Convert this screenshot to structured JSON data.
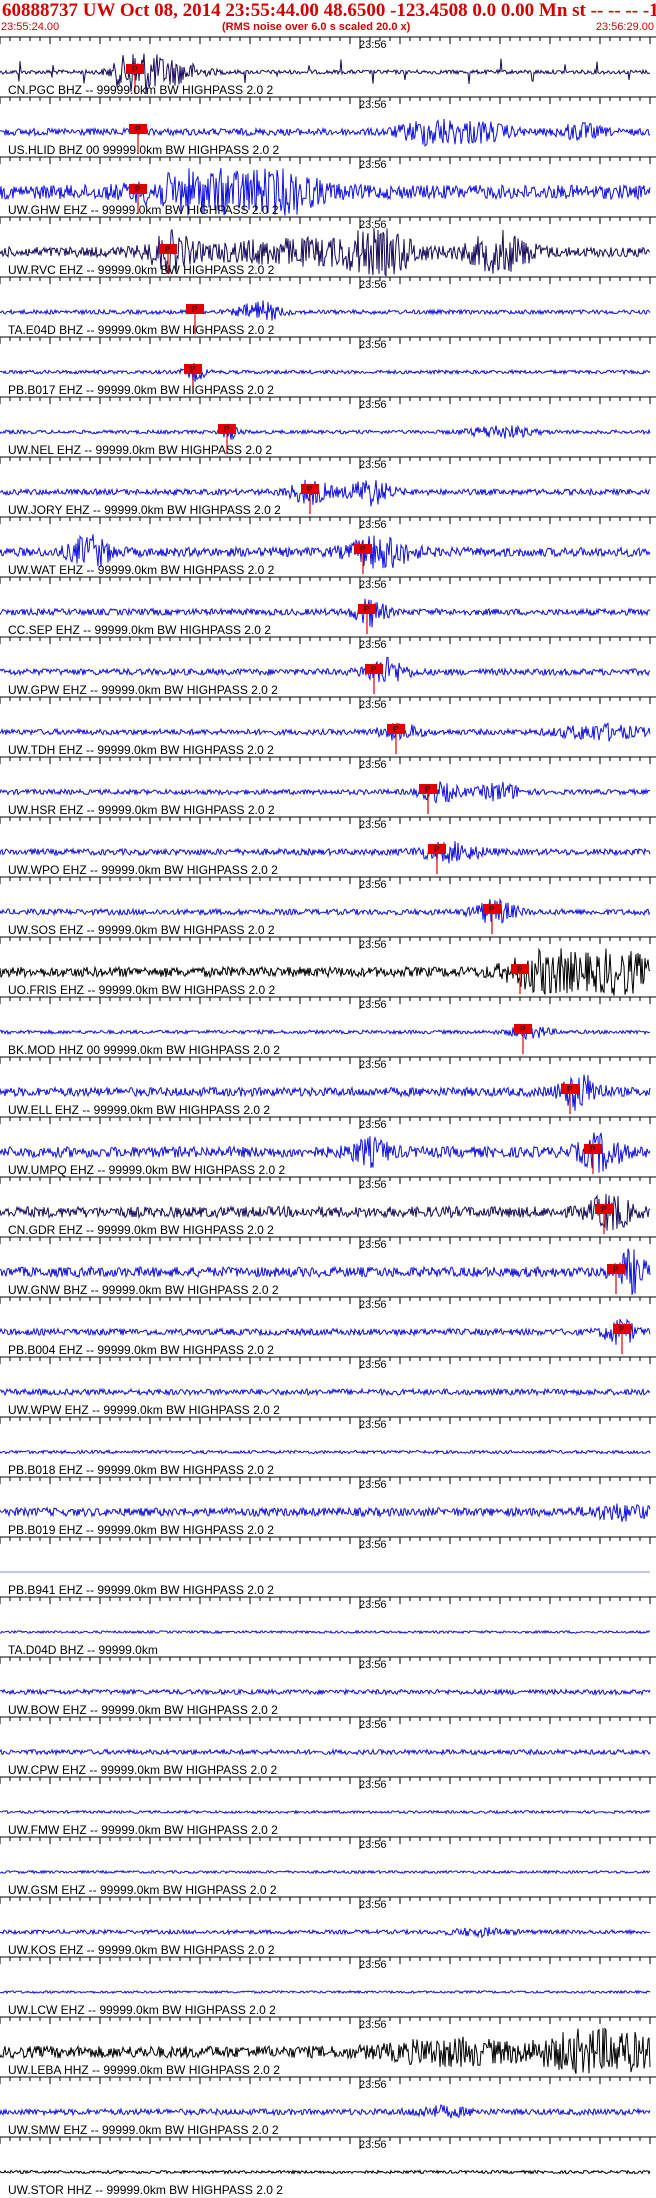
{
  "header": {
    "title": "60888737 UW Oct 08, 2014 23:55:44.00   48.6500  -123.4508  0.0 0.00 Mn st -- -- --  -1",
    "start_time": "23:55:24.00",
    "subtitle": "(RMS noise over 6.0 s scaled 20.0 x)",
    "end_time": "23:56:29.00"
  },
  "colors": {
    "title_red": "#d40000",
    "blue_trace": "#1010e0",
    "navy_trace": "#1a0a5c",
    "black_trace": "#000000",
    "pick_red": "#e00000"
  },
  "chart_data": {
    "type": "line",
    "x_unit": "s",
    "x_start": "23:55:24.00",
    "x_end": "23:56:29.00",
    "x_range": [
      0,
      65
    ],
    "minute_label": "23:56",
    "minute_offset_s": 36,
    "pick_label": "P",
    "stations": [
      {
        "label": "CN.PGC BHZ -- 99999.0km BW  HIGHPASS  2.0  2",
        "color": "navy",
        "pick_s": 13.5,
        "amp": 1.0,
        "event": [
          {
            "t": 13.5,
            "a": 1.0,
            "w": 2
          },
          {
            "t": 17,
            "a": 0.6,
            "w": 3
          }
        ],
        "noise": 0.1,
        "spikes": true
      },
      {
        "label": "US.HLID BHZ 00 99999.0km BW  HIGHPASS  2.0  2",
        "color": "blue",
        "pick_s": 13.8,
        "amp": 0.7,
        "event": [
          {
            "t": 43,
            "a": 0.8,
            "w": 3
          },
          {
            "t": 48,
            "a": 0.6,
            "w": 3
          },
          {
            "t": 58,
            "a": 0.5,
            "w": 2
          }
        ],
        "noise": 0.25
      },
      {
        "label": "UW.GHW EHZ -- 99999.0km BW  HIGHPASS  2.0  2",
        "color": "blue",
        "pick_s": 13.8,
        "amp": 1.0,
        "event": [
          {
            "t": 21,
            "a": 1.0,
            "w": 6
          },
          {
            "t": 28,
            "a": 0.8,
            "w": 4
          }
        ],
        "noise": 0.35
      },
      {
        "label": "UW.RVC EHZ -- 99999.0km BW  HIGHPASS  2.0  2",
        "color": "navy",
        "pick_s": 16.8,
        "amp": 1.0,
        "event": [
          {
            "t": 17,
            "a": 0.8,
            "w": 2
          },
          {
            "t": 38,
            "a": 1.0,
            "w": 3
          },
          {
            "t": 50,
            "a": 0.9,
            "w": 3
          },
          {
            "t": 30,
            "a": 0.5,
            "w": 10
          }
        ],
        "noise": 0.25
      },
      {
        "label": "TA.E04D BHZ -- 99999.0km BW  HIGHPASS  2.0  2",
        "color": "blue",
        "pick_s": 19.5,
        "amp": 0.7,
        "event": [
          {
            "t": 26,
            "a": 0.7,
            "w": 2
          }
        ],
        "noise": 0.15
      },
      {
        "label": "PB.B017 EHZ -- 99999.0km BW  HIGHPASS  2.0  2",
        "color": "blue",
        "pick_s": 19.3,
        "amp": 0.6,
        "event": [
          {
            "t": 19.5,
            "a": 0.7,
            "w": 1
          }
        ],
        "noise": 0.15
      },
      {
        "label": "UW.NEL EHZ -- 99999.0km BW  HIGHPASS  2.0  2",
        "color": "blue",
        "pick_s": 22.7,
        "amp": 0.6,
        "event": [
          {
            "t": 23,
            "a": 0.5,
            "w": 1
          },
          {
            "t": 50,
            "a": 0.5,
            "w": 3
          }
        ],
        "noise": 0.15
      },
      {
        "label": "UW.JORY EHZ -- 99999.0km BW  HIGHPASS  2.0  2",
        "color": "blue",
        "pick_s": 31.0,
        "amp": 0.8,
        "event": [
          {
            "t": 31,
            "a": 0.7,
            "w": 2
          },
          {
            "t": 37,
            "a": 0.8,
            "w": 2
          }
        ],
        "noise": 0.18
      },
      {
        "label": "UW.WAT EHZ -- 99999.0km BW  HIGHPASS  2.0  2",
        "color": "blue",
        "pick_s": 36.3,
        "amp": 0.9,
        "event": [
          {
            "t": 9,
            "a": 0.8,
            "w": 2
          },
          {
            "t": 38,
            "a": 0.8,
            "w": 3
          }
        ],
        "noise": 0.25
      },
      {
        "label": "CC.SEP EHZ -- 99999.0km BW  HIGHPASS  2.0  2",
        "color": "blue",
        "pick_s": 36.7,
        "amp": 0.8,
        "event": [
          {
            "t": 37,
            "a": 0.8,
            "w": 1.5
          }
        ],
        "noise": 0.2
      },
      {
        "label": "UW.GPW EHZ -- 99999.0km BW  HIGHPASS  2.0  2",
        "color": "blue",
        "pick_s": 37.4,
        "amp": 0.8,
        "event": [
          {
            "t": 38.5,
            "a": 0.8,
            "w": 2
          }
        ],
        "noise": 0.2
      },
      {
        "label": "UW.TDH EHZ -- 99999.0km BW  HIGHPASS  2.0  2",
        "color": "blue",
        "pick_s": 39.6,
        "amp": 0.7,
        "event": [
          {
            "t": 40,
            "a": 0.5,
            "w": 2
          },
          {
            "t": 60,
            "a": 0.5,
            "w": 4
          }
        ],
        "noise": 0.2
      },
      {
        "label": "UW.HSR EHZ -- 99999.0km BW  HIGHPASS  2.0  2",
        "color": "blue",
        "pick_s": 42.8,
        "amp": 0.7,
        "event": [
          {
            "t": 44,
            "a": 0.6,
            "w": 2
          },
          {
            "t": 50,
            "a": 0.6,
            "w": 2
          }
        ],
        "noise": 0.18
      },
      {
        "label": "UW.WPO EHZ -- 99999.0km BW  HIGHPASS  2.0  2",
        "color": "blue",
        "pick_s": 43.7,
        "amp": 0.7,
        "event": [
          {
            "t": 45,
            "a": 0.6,
            "w": 3
          }
        ],
        "noise": 0.22
      },
      {
        "label": "UW.SOS EHZ -- 99999.0km BW  HIGHPASS  2.0  2",
        "color": "blue",
        "pick_s": 49.2,
        "amp": 0.8,
        "event": [
          {
            "t": 49.5,
            "a": 0.7,
            "w": 2
          }
        ],
        "noise": 0.18
      },
      {
        "label": "UO.FRIS EHZ -- 99999.0km BW  HIGHPASS  2.0  2",
        "color": "black",
        "pick_s": 52.0,
        "amp": 1.0,
        "event": [
          {
            "t": 55,
            "a": 1.0,
            "w": 4
          },
          {
            "t": 62,
            "a": 1.0,
            "w": 3
          }
        ],
        "noise": 0.25
      },
      {
        "label": "BK.MOD HHZ 00 99999.0km BW  HIGHPASS  2.0  2",
        "color": "blue",
        "pick_s": 52.3,
        "amp": 0.6,
        "event": [
          {
            "t": 53,
            "a": 0.5,
            "w": 2
          }
        ],
        "noise": 0.15
      },
      {
        "label": "UW.ELL EHZ -- 99999.0km BW  HIGHPASS  2.0  2",
        "color": "blue",
        "pick_s": 57.0,
        "amp": 0.9,
        "event": [
          {
            "t": 58,
            "a": 0.9,
            "w": 2
          }
        ],
        "noise": 0.25
      },
      {
        "label": "UW.UMPQ EHZ -- 99999.0km BW  HIGHPASS  2.0  2",
        "color": "blue",
        "pick_s": 59.3,
        "amp": 0.9,
        "event": [
          {
            "t": 37,
            "a": 0.6,
            "w": 2
          },
          {
            "t": 60,
            "a": 0.9,
            "w": 2
          }
        ],
        "noise": 0.3
      },
      {
        "label": "CN.GDR EHZ -- 99999.0km BW  HIGHPASS  2.0  2",
        "color": "navy",
        "pick_s": 60.4,
        "amp": 0.9,
        "event": [
          {
            "t": 61,
            "a": 0.9,
            "w": 2
          }
        ],
        "noise": 0.3
      },
      {
        "label": "UW.GNW BHZ -- 99999.0km BW  HIGHPASS  2.0  2",
        "color": "blue",
        "pick_s": 61.6,
        "amp": 1.0,
        "event": [
          {
            "t": 63,
            "a": 1.0,
            "w": 1.5
          }
        ],
        "noise": 0.25
      },
      {
        "label": "PB.B004 EHZ -- 99999.0km BW  HIGHPASS  2.0  2",
        "color": "blue",
        "pick_s": 62.2,
        "amp": 0.8,
        "event": [
          {
            "t": 62,
            "a": 0.8,
            "w": 1.5
          }
        ],
        "noise": 0.2
      },
      {
        "label": "UW.WPW EHZ -- 99999.0km BW  HIGHPASS  2.0  2",
        "color": "blue",
        "pick_s": null,
        "amp": 0.5,
        "event": [],
        "noise": 0.3
      },
      {
        "label": "PB.B018 EHZ -- 99999.0km BW  HIGHPASS  2.0  2",
        "color": "blue",
        "pick_s": null,
        "amp": 0.4,
        "event": [],
        "noise": 0.2
      },
      {
        "label": "PB.B019 EHZ -- 99999.0km BW  HIGHPASS  2.0  2",
        "color": "blue",
        "pick_s": null,
        "amp": 0.6,
        "event": [
          {
            "t": 62,
            "a": 0.5,
            "w": 3
          }
        ],
        "noise": 0.35
      },
      {
        "label": "PB.B941 EHZ -- 99999.0km BW  HIGHPASS  2.0  2",
        "color": "blue",
        "pick_s": null,
        "amp": 0.0,
        "event": [],
        "noise": 0.0
      },
      {
        "label": "TA.D04D BHZ -- 99999.0km",
        "color": "blue",
        "pick_s": null,
        "amp": 0.3,
        "event": [],
        "noise": 0.2
      },
      {
        "label": "UW.BOW EHZ -- 99999.0km BW  HIGHPASS  2.0  2",
        "color": "blue",
        "pick_s": null,
        "amp": 0.4,
        "event": [],
        "noise": 0.3
      },
      {
        "label": "UW.CPW EHZ -- 99999.0km BW  HIGHPASS  2.0  2",
        "color": "blue",
        "pick_s": null,
        "amp": 0.4,
        "event": [],
        "noise": 0.3
      },
      {
        "label": "UW.FMW EHZ -- 99999.0km BW  HIGHPASS  2.0  2",
        "color": "blue",
        "pick_s": null,
        "amp": 0.3,
        "event": [],
        "noise": 0.22
      },
      {
        "label": "UW.GSM EHZ -- 99999.0km BW  HIGHPASS  2.0  2",
        "color": "blue",
        "pick_s": null,
        "amp": 0.3,
        "event": [],
        "noise": 0.22
      },
      {
        "label": "UW.KOS EHZ -- 99999.0km BW  HIGHPASS  2.0  2",
        "color": "blue",
        "pick_s": null,
        "amp": 0.4,
        "event": [
          {
            "t": 48,
            "a": 0.4,
            "w": 3
          }
        ],
        "noise": 0.25
      },
      {
        "label": "UW.LCW EHZ -- 99999.0km BW  HIGHPASS  2.0  2",
        "color": "blue",
        "pick_s": null,
        "amp": 0.3,
        "event": [],
        "noise": 0.2
      },
      {
        "label": "UW.LEBA HHZ -- 99999.0km BW  HIGHPASS  2.0  2",
        "color": "black",
        "pick_s": null,
        "amp": 1.0,
        "event": [
          {
            "t": 60,
            "a": 1.0,
            "w": 6
          },
          {
            "t": 45,
            "a": 0.5,
            "w": 6
          }
        ],
        "noise": 0.3
      },
      {
        "label": "UW.SMW EHZ -- 99999.0km BW  HIGHPASS  2.0  2",
        "color": "blue",
        "pick_s": null,
        "amp": 0.5,
        "event": [
          {
            "t": 44,
            "a": 0.4,
            "w": 3
          }
        ],
        "noise": 0.3
      },
      {
        "label": "UW.STOR HHZ -- 99999.0km BW  HIGHPASS  2.0  2",
        "color": "black",
        "pick_s": null,
        "amp": 0.3,
        "event": [],
        "noise": 0.25
      }
    ]
  }
}
